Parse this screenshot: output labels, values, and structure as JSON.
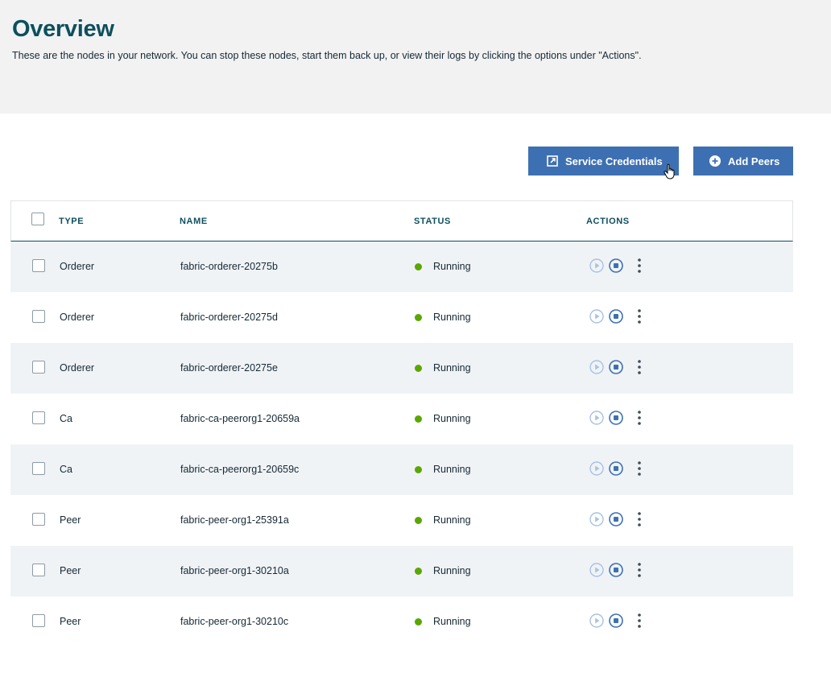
{
  "page": {
    "title": "Overview",
    "subtitle": "These are the nodes in your network. You can stop these nodes, start them back up, or view their logs by clicking the options under \"Actions\"."
  },
  "toolbar": {
    "service_credentials_label": "Service Credentials",
    "add_peers_label": "Add Peers"
  },
  "table": {
    "headers": {
      "type": "TYPE",
      "name": "NAME",
      "status": "STATUS",
      "actions": "ACTIONS"
    },
    "rows": [
      {
        "type": "Orderer",
        "name": "fabric-orderer-20275b",
        "status": "Running"
      },
      {
        "type": "Orderer",
        "name": "fabric-orderer-20275d",
        "status": "Running"
      },
      {
        "type": "Orderer",
        "name": "fabric-orderer-20275e",
        "status": "Running"
      },
      {
        "type": "Ca",
        "name": "fabric-ca-peerorg1-20659a",
        "status": "Running"
      },
      {
        "type": "Ca",
        "name": "fabric-ca-peerorg1-20659c",
        "status": "Running"
      },
      {
        "type": "Peer",
        "name": "fabric-peer-org1-25391a",
        "status": "Running"
      },
      {
        "type": "Peer",
        "name": "fabric-peer-org1-30210a",
        "status": "Running"
      },
      {
        "type": "Peer",
        "name": "fabric-peer-org1-30210c",
        "status": "Running"
      }
    ]
  },
  "icons": {
    "service_credentials": "launch-icon",
    "add_peers": "add-circle-icon",
    "start": "play-icon",
    "stop": "stop-icon",
    "more": "overflow-menu-icon",
    "status": "status-dot-icon"
  },
  "colors": {
    "title": "#0d4f5e",
    "button": "#3d70b2",
    "running": "#5aa700",
    "header_bg": "#f2f2f2",
    "row_shade": "#f0f3f6"
  }
}
